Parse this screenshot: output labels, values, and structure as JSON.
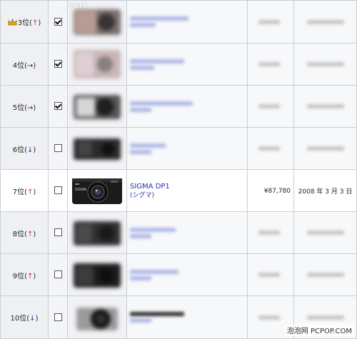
{
  "header": {
    "site_logo": "COM"
  },
  "colors": {
    "up_arrow": "#c0392b",
    "down_arrow": "#1f3d99",
    "link": "#2233aa",
    "border": "#c9ced6"
  },
  "rows": [
    {
      "rank": "3位",
      "trend": "↑",
      "checked": true,
      "has_crown": true
    },
    {
      "rank": "4位",
      "trend": "→",
      "checked": true
    },
    {
      "rank": "5位",
      "trend": "→",
      "checked": true
    },
    {
      "rank": "6位",
      "trend": "↓",
      "checked": false
    },
    {
      "rank": "7位",
      "trend": "↑",
      "checked": false,
      "name": "SIGMA DP1",
      "brand": "(シグマ)",
      "price": "¥87,780",
      "date": "2008 年 3 月 3 日"
    },
    {
      "rank": "8位",
      "trend": "↑",
      "checked": false
    },
    {
      "rank": "9位",
      "trend": "↑",
      "checked": false
    },
    {
      "rank": "10位",
      "trend": "↓",
      "checked": false
    }
  ],
  "watermark": "泡泡网 PCPOP.COM"
}
